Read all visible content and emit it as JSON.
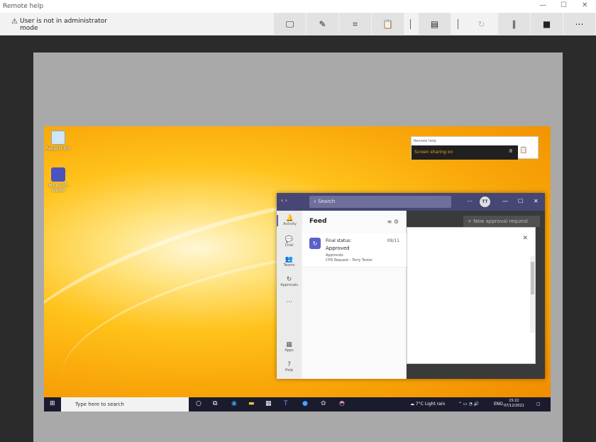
{
  "window": {
    "title": "Remote help",
    "minimize": "—",
    "maximize": "☐",
    "close": "✕"
  },
  "warning": {
    "icon": "⚠",
    "text": "User is not in administrator mode"
  },
  "toolbar": {
    "buttons": [
      {
        "name": "view-screen",
        "glyph": "🖵"
      },
      {
        "name": "annotate",
        "glyph": "✎"
      },
      {
        "name": "full-screen",
        "glyph": "⌗"
      },
      {
        "name": "clipboard",
        "glyph": "📋"
      },
      {
        "name": "task-manager",
        "glyph": "▤"
      },
      {
        "name": "refresh",
        "glyph": "↻"
      },
      {
        "name": "pause",
        "glyph": "∥"
      },
      {
        "name": "stop",
        "glyph": "■"
      },
      {
        "name": "more",
        "glyph": "⋯"
      }
    ]
  },
  "desktop": {
    "icons": [
      {
        "label": "Recycle Bin"
      },
      {
        "label": "Microsoft Teams"
      }
    ]
  },
  "remote_help_mini": {
    "title": "Remote help",
    "status": "Screen sharing on",
    "pause": "II"
  },
  "teams": {
    "search_placeholder": "Search",
    "avatar": "TT",
    "new_request": "+ New approval request",
    "rail": [
      {
        "label": "Activity",
        "glyph": "🔔"
      },
      {
        "label": "Chat",
        "glyph": "💬"
      },
      {
        "label": "Teams",
        "glyph": "👥"
      },
      {
        "label": "Approvals",
        "glyph": "↻"
      },
      {
        "label": "Apps",
        "glyph": "▦"
      },
      {
        "label": "Help",
        "glyph": "?"
      }
    ],
    "feed": {
      "title": "Feed",
      "notification": {
        "status_label": "Final status:",
        "status_value": "Approved",
        "source": "Approvals",
        "detail": "CPD Request - Terry Tester",
        "date": "09/11"
      }
    }
  },
  "taskbar": {
    "search_placeholder": "Type here to search",
    "weather": "7°C Light rain",
    "lang": "ENG",
    "time": "15:22",
    "date": "07/12/2021"
  }
}
